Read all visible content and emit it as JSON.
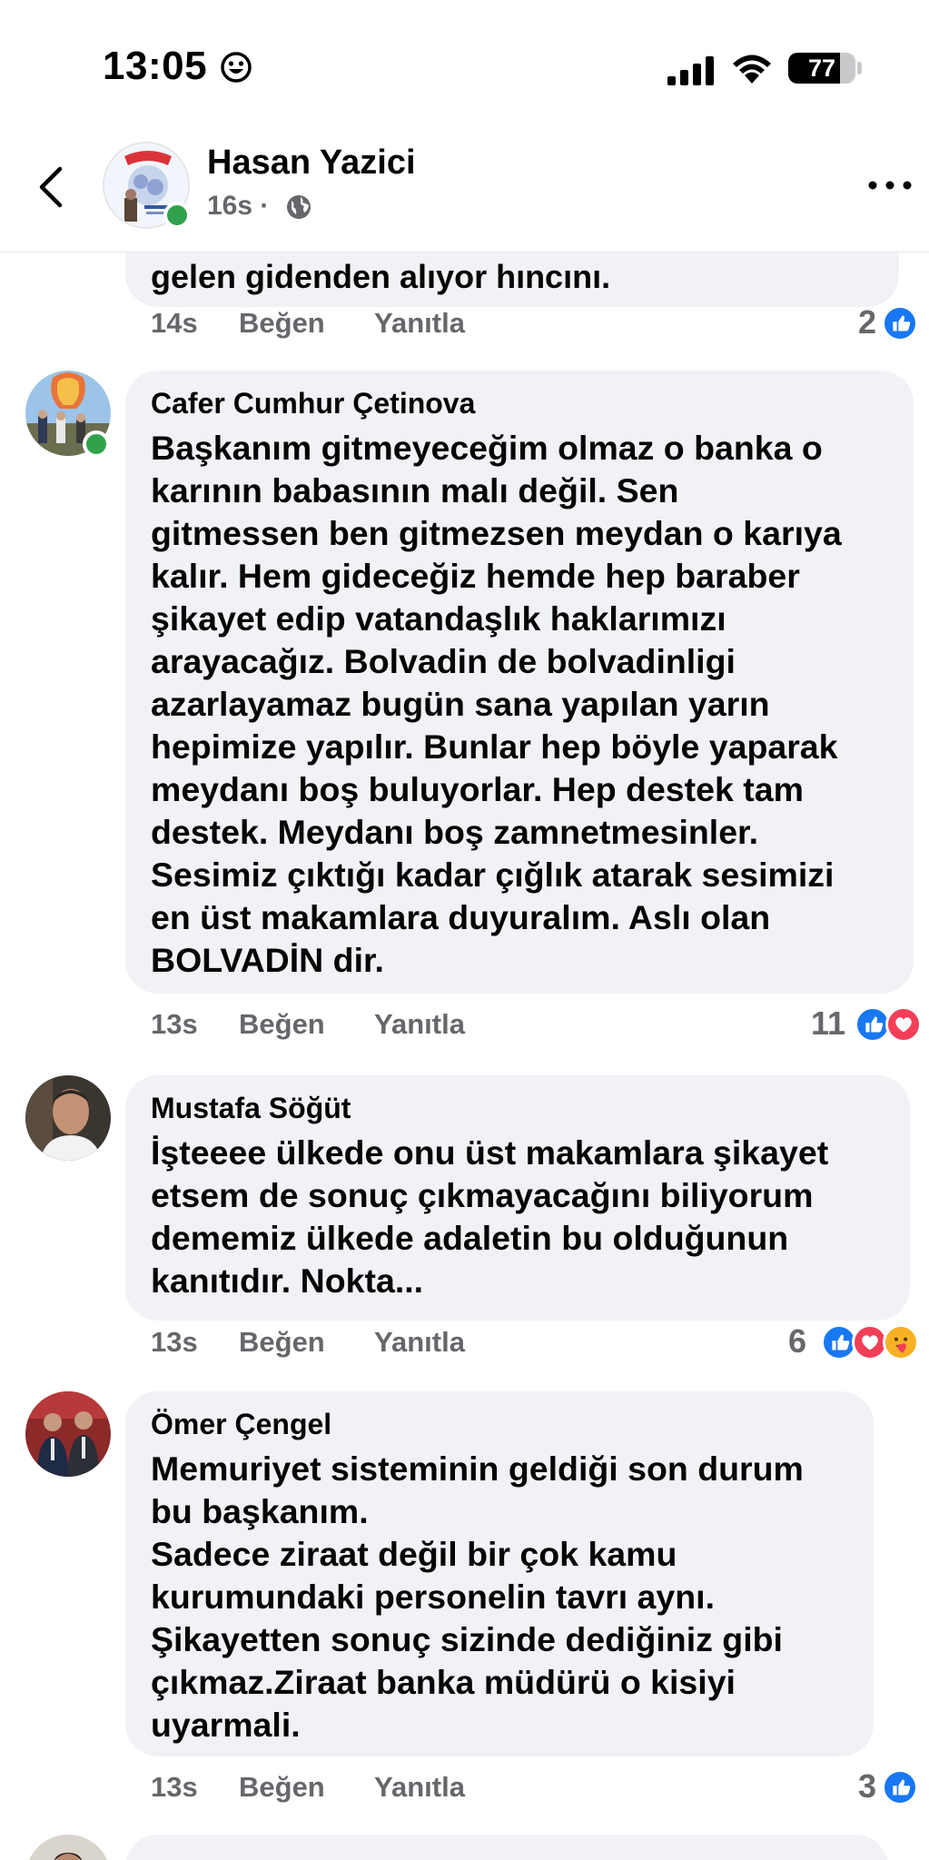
{
  "status_bar": {
    "time": "13:05",
    "battery_level": "77"
  },
  "header": {
    "name": "Hasan Yazici",
    "meta": "16s ·"
  },
  "previous_comment": {
    "text_tail": "gelen gidenden alıyor hıncını.",
    "time": "14s",
    "like_label": "Beğen",
    "reply_label": "Yanıtla",
    "reaction_count": "2",
    "reactions": [
      "like-icon"
    ]
  },
  "comments": [
    {
      "author": "Cafer Cumhur Çetinova",
      "text": "Başkanım gitmeyeceğim olmaz o banka o\nkarının babasının malı değil. Sen\ngitmessen ben gitmezsen meydan o karıya\nkalır. Hem gideceğiz hemde hep baraber\nşikayet edip vatandaşlık haklarımızı\narayacağız. Bolvadin de bolvadinligi\nazarlayamaz bugün sana yapılan yarın\nhepimize yapılır. Bunlar hep böyle yaparak\nmeydanı boş buluyorlar. Hep destek tam\ndestek. Meydanı boş zamnetmesinler.\nSesimiz çıktığı kadar çığlık atarak sesimizi\nen üst makamlara duyuralım. Aslı olan\nBOLVADİN dir.",
      "time": "13s",
      "like_label": "Beğen",
      "reply_label": "Yanıtla",
      "reaction_count": "11",
      "reactions": [
        "like-icon",
        "love-icon"
      ],
      "online": true
    },
    {
      "author": "Mustafa Söğüt",
      "text": "İşteeee ülkede  onu üst makamlara şikayet\netsem de  sonuç çıkmayacağını biliyorum\ndememiz ülkede adaletin bu olduğunun\nkanıtıdır. Nokta...",
      "time": "13s",
      "like_label": "Beğen",
      "reply_label": "Yanıtla",
      "reaction_count": "6",
      "reactions": [
        "like-icon",
        "love-icon",
        "care-icon"
      ],
      "online": false
    },
    {
      "author": "Ömer Çengel",
      "text": "Memuriyet sisteminin geldiği son durum\nbu başkanım.\nSadece ziraat değil bir çok kamu\nkurumundaki personelin tavrı aynı.\nŞikayetten sonuç sizinde dediğiniz gibi\nçıkmaz.Ziraat banka müdürü o kisiyi\nuyarmali.",
      "time": "13s",
      "like_label": "Beğen",
      "reply_label": "Yanıtla",
      "reaction_count": "3",
      "reactions": [
        "like-icon"
      ],
      "online": false
    }
  ],
  "colors": {
    "bubble": "#f0f2f5",
    "meta_text": "#65676b",
    "like_blue": "#1877f2",
    "love_red": "#f33e58",
    "online_green": "#31a24c"
  }
}
